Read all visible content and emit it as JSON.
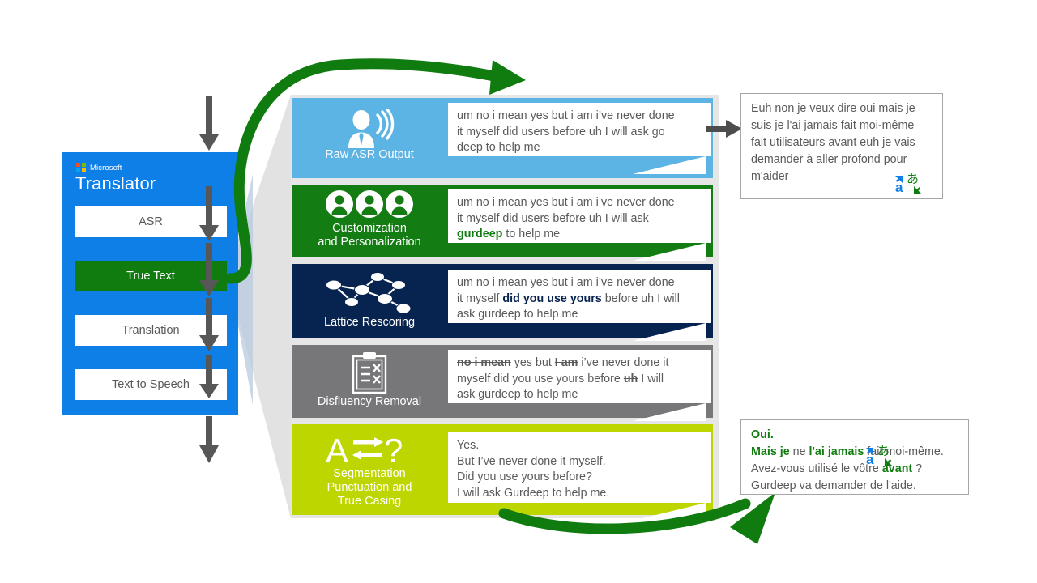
{
  "panel": {
    "brand_small": "Microsoft",
    "brand_main": "Translator",
    "steps": [
      {
        "label": "ASR",
        "active": false
      },
      {
        "label": "True Text",
        "active": true
      },
      {
        "label": "Translation",
        "active": false
      },
      {
        "label": "Text to Speech",
        "active": false
      }
    ],
    "colors": {
      "panel_blue": "#0f7fe8",
      "active_green": "#107c10"
    }
  },
  "stages": [
    {
      "id": "raw-asr-output",
      "label": "Raw ASR Output",
      "icon": "speaker-person-icon",
      "color": "#5cb4e4",
      "text_lines": [
        "um no i mean yes but i am i’ve never done",
        "it myself did users before uh I will ask go",
        "deep to help me"
      ]
    },
    {
      "id": "customization-and-personalization",
      "label": "Customization\nand Personalization",
      "label_line1": "Customization",
      "label_line2": "and Personalization",
      "icon": "three-people-icon",
      "color": "#137c12",
      "text_lines": [
        "um no i mean yes but i am i’ve never done",
        "it myself did users before uh I will ask",
        "gurdeep to help me"
      ],
      "highlight": "gurdeep"
    },
    {
      "id": "lattice-rescoring",
      "label": "Lattice Rescoring",
      "icon": "lattice-graph-icon",
      "color": "#07234f",
      "text_lines": [
        "um no i mean yes but i am i’ve never done",
        "it myself did you use yours before uh I will",
        "ask gurdeep to help me"
      ],
      "highlight": "did you use yours"
    },
    {
      "id": "disfluency-removal",
      "label": "Disfluency Removal",
      "icon": "clipboard-strike-icon",
      "color": "#77777a",
      "text_lines": [
        "no i mean yes but I am i’ve never done it",
        "myself did you use yours before uh I will",
        "ask gurdeep to help me"
      ],
      "struck": [
        "no i mean",
        "I am",
        "uh"
      ]
    },
    {
      "id": "segmentation-punctuation-true-casing",
      "label_line1": "Segmentation",
      "label_line2": "Punctuation and",
      "label_line3": "True Casing",
      "icon": "a-arrows-question-icon",
      "color": "#bed600",
      "text_lines": [
        "Yes.",
        "But I’ve never done it myself.",
        "Did you use yours before?",
        "I will ask Gurdeep to help me."
      ]
    }
  ],
  "callouts": {
    "top": {
      "id": "raw-translation-callout",
      "lines": [
        "Euh non je veux dire oui mais je",
        "suis je l'ai jamais fait moi-même",
        "fait utilisateurs avant euh je vais",
        "demander à aller profond pour",
        "m'aider"
      ],
      "icon": "translate-icon"
    },
    "bottom": {
      "id": "truetext-translation-callout",
      "lines": [
        "Oui.",
        "Mais je ne l'ai jamais fait moi-même.",
        "Avez-vous utilisé le vôtre avant ?",
        "Gurdeep va demander de l'aide."
      ],
      "bold_green_terms": [
        "Oui.",
        "Mais je",
        "l'ai jamais",
        "avant"
      ],
      "icon": "translate-icon"
    }
  },
  "arrows": {
    "loop_color": "#107c10",
    "flow_color": "#575757",
    "funnel_color": "#e2e2e2"
  }
}
